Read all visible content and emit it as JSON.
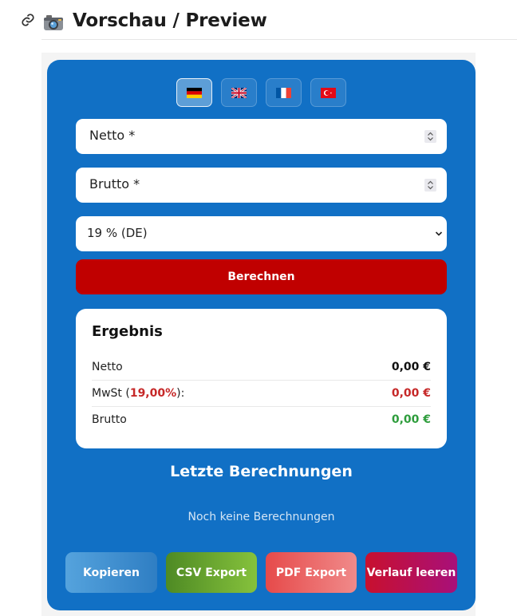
{
  "header": {
    "title": "Vorschau / Preview",
    "icons": [
      "link-icon",
      "camera-icon"
    ]
  },
  "widget": {
    "background_color": "#1170c5",
    "languages": [
      {
        "code": "de",
        "flag": "flag-de-icon",
        "active": true
      },
      {
        "code": "en",
        "flag": "flag-gb-icon",
        "active": false
      },
      {
        "code": "fr",
        "flag": "flag-fr-icon",
        "active": false
      },
      {
        "code": "tr",
        "flag": "flag-tr-icon",
        "active": false
      }
    ],
    "net_field": {
      "placeholder": "Netto *"
    },
    "gross_field": {
      "placeholder": "Brutto *"
    },
    "vat_select": {
      "selected": "19 % (DE)"
    },
    "calculate_label": "Berechnen",
    "calculate_color": "#c00000",
    "result": {
      "title": "Ergebnis",
      "net_label": "Netto",
      "net_value": "0,00 €",
      "vat_label_prefix": "MwSt (",
      "vat_rate": "19,00%",
      "vat_label_suffix": "):",
      "vat_value": "0,00 €",
      "vat_color": "#c62828",
      "gross_label": "Brutto",
      "gross_value": "0,00 €",
      "gross_color": "#2e9d3c"
    },
    "history": {
      "title": "Letzte Berechnungen",
      "empty_text": "Noch keine Berechnungen"
    },
    "actions": {
      "copy_label": "Kopieren",
      "csv_label": "CSV Export",
      "pdf_label": "PDF Export",
      "clear_label": "Verlauf leeren"
    }
  }
}
